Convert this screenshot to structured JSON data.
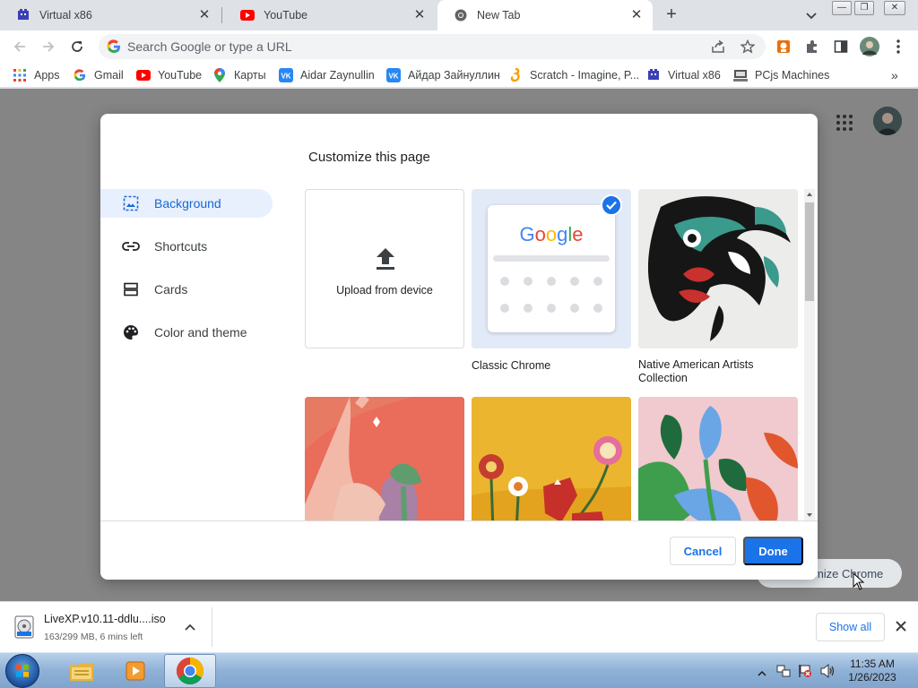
{
  "tabs": [
    {
      "title": "Virtual x86",
      "favicon": "x86-icon"
    },
    {
      "title": "YouTube",
      "favicon": "youtube-icon"
    },
    {
      "title": "New Tab",
      "favicon": "chrome-icon",
      "active": true
    }
  ],
  "omnibox": {
    "placeholder": "Search Google or type a URL"
  },
  "bookmarks": [
    {
      "label": "Apps",
      "icon": "apps-grid-icon"
    },
    {
      "label": "Gmail",
      "icon": "google-icon"
    },
    {
      "label": "YouTube",
      "icon": "youtube-icon"
    },
    {
      "label": "Карты",
      "icon": "maps-pin-icon"
    },
    {
      "label": "Aidar Zaynullin",
      "icon": "vk-icon"
    },
    {
      "label": "Айдар Зайнуллин",
      "icon": "vk-icon"
    },
    {
      "label": "Scratch - Imagine, P...",
      "icon": "scratch-icon"
    },
    {
      "label": "Virtual x86",
      "icon": "x86-icon"
    },
    {
      "label": "PCjs Machines",
      "icon": "pcjs-icon"
    }
  ],
  "dialog": {
    "title": "Customize this page",
    "sidebar": [
      {
        "label": "Background",
        "icon": "image-icon",
        "selected": true
      },
      {
        "label": "Shortcuts",
        "icon": "link-icon"
      },
      {
        "label": "Cards",
        "icon": "cards-icon"
      },
      {
        "label": "Color and theme",
        "icon": "palette-icon"
      }
    ],
    "tiles": [
      {
        "label": "Upload from device",
        "kind": "upload"
      },
      {
        "label": "Classic Chrome",
        "kind": "classic",
        "selected": true
      },
      {
        "label": "Native American Artists Collection",
        "kind": "art"
      }
    ],
    "classic_logo": "Google",
    "cancel_label": "Cancel",
    "done_label": "Done"
  },
  "page": {
    "customize_chip": "Customize Chrome"
  },
  "download": {
    "filename": "LiveXP.v10.11-ddlu....iso",
    "status": "163/299 MB, 6 mins left",
    "show_all": "Show all"
  },
  "taskbar": {
    "time": "11:35 AM",
    "date": "1/26/2023"
  },
  "colors": {
    "accent": "#1a73e8",
    "selected_bg": "#e8f0fe",
    "backdrop": "#858585"
  }
}
